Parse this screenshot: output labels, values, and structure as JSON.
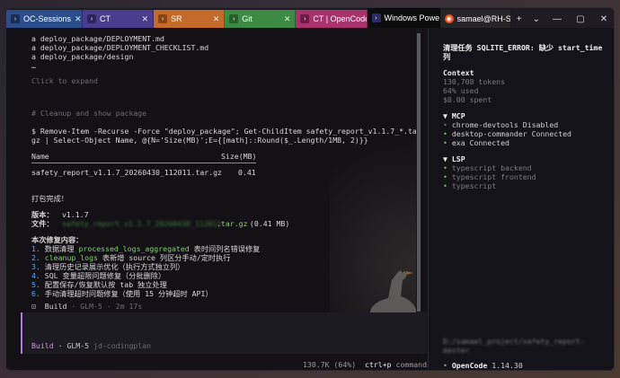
{
  "tabs": [
    {
      "label": "OC-Sessions",
      "color": "#2b4e8a",
      "icon": "terminal-icon",
      "active": false
    },
    {
      "label": "CT",
      "color": "#4a3d8e",
      "icon": "terminal-icon",
      "active": false
    },
    {
      "label": "SR",
      "color": "#c46a2a",
      "icon": "terminal-icon",
      "active": false
    },
    {
      "label": "Git",
      "color": "#3d8a45",
      "icon": "terminal-icon",
      "active": false
    },
    {
      "label": "CT | OpenCode",
      "color": "#a8326b",
      "icon": "terminal-icon",
      "active": false
    },
    {
      "label": "Windows PowerS",
      "color": "#0c0c0c",
      "icon": "powershell-icon",
      "active": true
    },
    {
      "label": "samael@RH-Samu",
      "color": "#262428",
      "icon": "ubuntu-icon",
      "active": false
    }
  ],
  "tabbar": {
    "new_tab": "+",
    "dropdown": "⌄",
    "minimize": "—",
    "maximize": "▢",
    "close": "✕"
  },
  "terminal": {
    "lines_top": [
      "a deploy_package/DEPLOYMENT.md",
      "a deploy_package/DEPLOYMENT_CHECKLIST.md",
      "a deploy_package/design",
      "…"
    ],
    "click_to_expand": "Click to expand",
    "comment": "# Cleanup and show package",
    "command_1": "$ Remove-Item -Recurse -Force \"deploy_package\"; Get-ChildItem safety_report_v1.1.7_*.tar.",
    "command_2": "gz | Select-Object Name, @{N='Size(MB)';E={[math]::Round($_.Length/1MB, 2)}}",
    "table_header": {
      "name": "Name",
      "size": "Size(MB)"
    },
    "table_row": {
      "name": "safety_report_v1.1.7_20260430_112011.tar.gz",
      "size": "0.41"
    },
    "pack_done": "打包完成！",
    "version_label": "版本：",
    "version_value": "v1.1.7",
    "file_label": "文件：",
    "file_blurred": "safety_report_v1.1.7_20260430_112011",
    "file_ext": ".tar.gz",
    "file_size": " (0.41 MB)",
    "fixes_title": "本次修复内容：",
    "fixes": [
      {
        "num": "1.",
        "pre": "数据清理 ",
        "code": "processed_logs_aggregated",
        "post": " 表时间列名错误修复"
      },
      {
        "num": "2.",
        "pre": "",
        "code": "cleanup_logs",
        "post": " 表新增 source 列区分手动/定时执行"
      },
      {
        "num": "3.",
        "pre": "清理历史记录展示优化（执行方式独立列）",
        "code": "",
        "post": ""
      },
      {
        "num": "4.",
        "pre": "SQL 变量超限问题修复（分批删除）",
        "code": "",
        "post": ""
      },
      {
        "num": "5.",
        "pre": "配置保存/恢复默认按 tab 独立处理",
        "code": "",
        "post": ""
      },
      {
        "num": "6.",
        "pre": "手动清理超时问题修复（使用 15 分钟超时 API）",
        "code": "",
        "post": ""
      }
    ],
    "build_marker": "⊡",
    "build_label": "Build",
    "build_meta": " · GLM-5 · 2m 17s",
    "input_status_mode": "Build",
    "input_status_model": " · GLM-5",
    "input_status_provider": " jd-codingplan",
    "bottom_tokens": "130.7K (64%)",
    "bottom_shortcut": "ctrl+p",
    "bottom_commands": "commands"
  },
  "sidebar": {
    "title_1": "清理任务 SQLITE_ERROR: 缺少 start_time",
    "title_2": "列",
    "context_heading": "Context",
    "tokens": "130,708 tokens",
    "used": "64% used",
    "spent": "$0.00 spent",
    "mcp_heading": "▼ MCP",
    "mcp": [
      {
        "name": "chrome-devtools",
        "status": "Disabled",
        "state": "off"
      },
      {
        "name": "desktop-commander",
        "status": "Connected",
        "state": "on"
      },
      {
        "name": "exa",
        "status": "Connected",
        "state": "on"
      }
    ],
    "lsp_heading": "▼ LSP",
    "lsp": [
      "typescript backend",
      "typescript frontend",
      "typescript"
    ],
    "path_blurred_1": "D:/samael_project/safety_report-",
    "path_blurred_2": "master",
    "footer_dot": "•",
    "footer_app": "OpenCode",
    "footer_version": "1.14.30"
  }
}
